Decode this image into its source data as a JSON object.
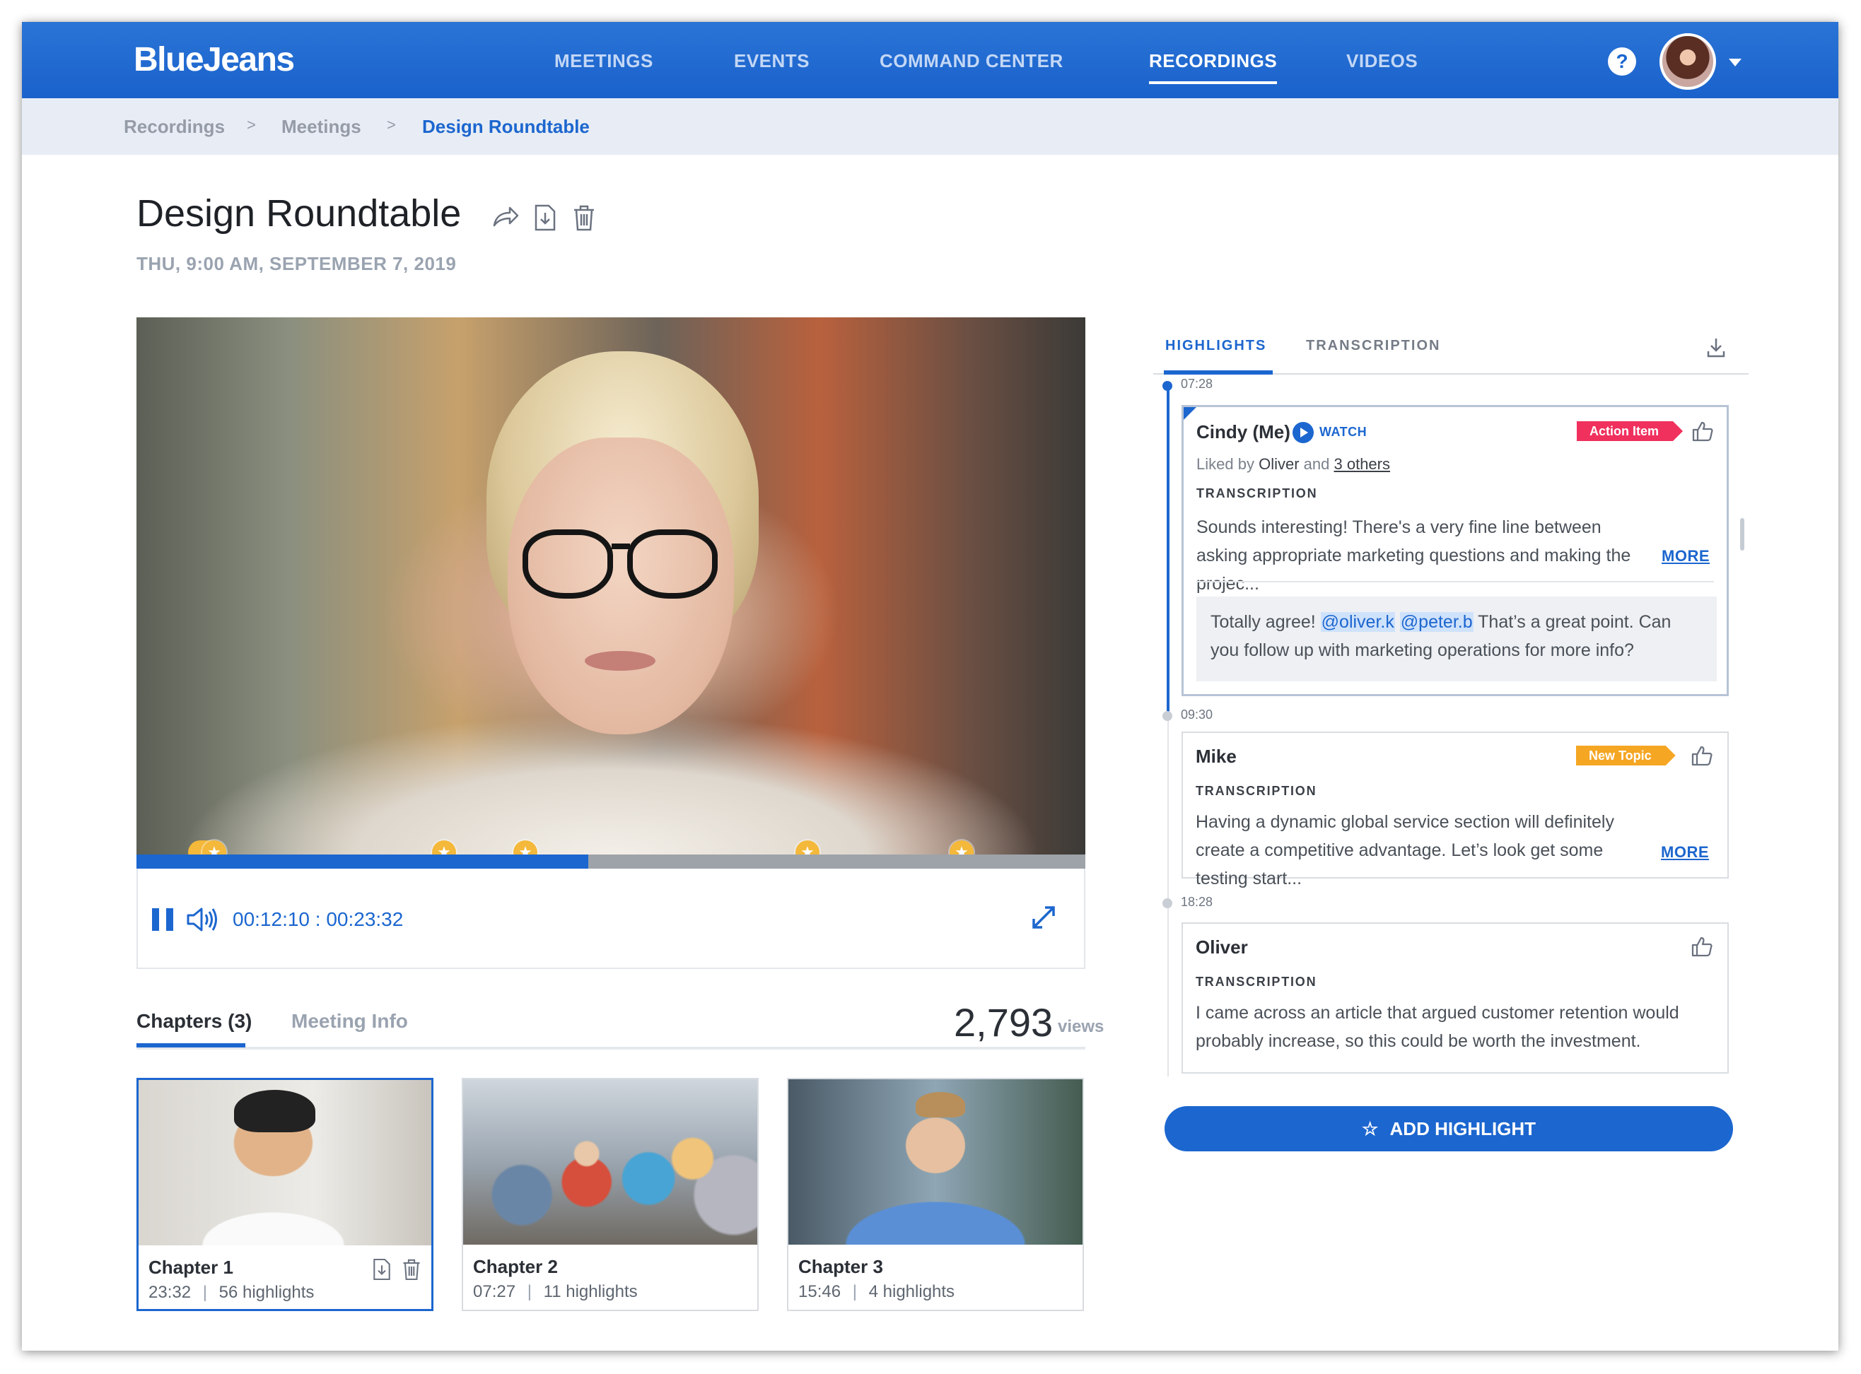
{
  "app": {
    "logo": "BlueJeans"
  },
  "nav": {
    "items": [
      {
        "label": "MEETINGS"
      },
      {
        "label": "EVENTS"
      },
      {
        "label": "COMMAND CENTER"
      },
      {
        "label": "RECORDINGS",
        "active": true
      },
      {
        "label": "VIDEOS"
      }
    ],
    "help": "?"
  },
  "breadcrumb": {
    "items": [
      "Recordings",
      "Meetings",
      "Design Roundtable"
    ],
    "separator": ">"
  },
  "recording": {
    "title": "Design Roundtable",
    "date": "THU,  9:00 AM, SEPTEMBER 7, 2019"
  },
  "player": {
    "timecode": "00:12:10 : 00:23:32",
    "progress_fraction": 0.476,
    "marker_icon": "★",
    "state": "playing"
  },
  "lower_tabs": {
    "chapters": "Chapters (3)",
    "meeting_info": "Meeting Info"
  },
  "views": {
    "count": "2,793",
    "label": "views"
  },
  "chapters": [
    {
      "title": "Chapter 1",
      "duration": "23:32",
      "sep": "|",
      "highlights": "56 highlights",
      "selected": true
    },
    {
      "title": "Chapter 2",
      "duration": "07:27",
      "sep": "|",
      "highlights": "11 highlights"
    },
    {
      "title": "Chapter 3",
      "duration": "15:46",
      "sep": "|",
      "highlights": "4 highlights"
    }
  ],
  "right_tabs": {
    "highlights": "HIGHLIGHTS",
    "transcription": "TRANSCRIPTION"
  },
  "highlights": [
    {
      "time": "07:28",
      "name": "Cindy (Me)",
      "watch": "WATCH",
      "tag": "Action Item",
      "liked_prefix": "Liked by",
      "liked_name": "Oliver",
      "liked_and": "and",
      "liked_others": "3 others",
      "label": "TRANSCRIPTION",
      "text": "Sounds interesting! There's a very fine line between asking appropriate marketing questions and making the projec...",
      "more": "MORE",
      "comment_prefix": "Totally agree!",
      "mention1": "@oliver.k",
      "mention2": "@peter.b",
      "comment_suffix": "That’s a great point. Can you follow up with marketing operations for more info?"
    },
    {
      "time": "09:30",
      "name": "Mike",
      "tag": "New Topic",
      "label": "TRANSCRIPTION",
      "text": "Having a dynamic global service section will definitely create a competitive advantage. Let’s look get some testing start...",
      "more": "MORE"
    },
    {
      "time": "18:28",
      "name": "Oliver",
      "label": "TRANSCRIPTION",
      "text": "I came across an article that argued customer retention would probably increase, so this could be worth the investment."
    }
  ],
  "add_highlight": {
    "icon": "☆",
    "label": "ADD HIGHLIGHT"
  },
  "colors": {
    "brand_blue": "#1c66cf",
    "action_item": "#f0305d",
    "new_topic": "#f5a623",
    "marker_gold": "#f4b83a"
  },
  "icons": [
    "share-icon",
    "download-icon",
    "trash-icon",
    "help-icon",
    "pause-icon",
    "volume-icon",
    "fullscreen-icon",
    "thumbs-up-icon",
    "play-icon",
    "star-icon"
  ]
}
